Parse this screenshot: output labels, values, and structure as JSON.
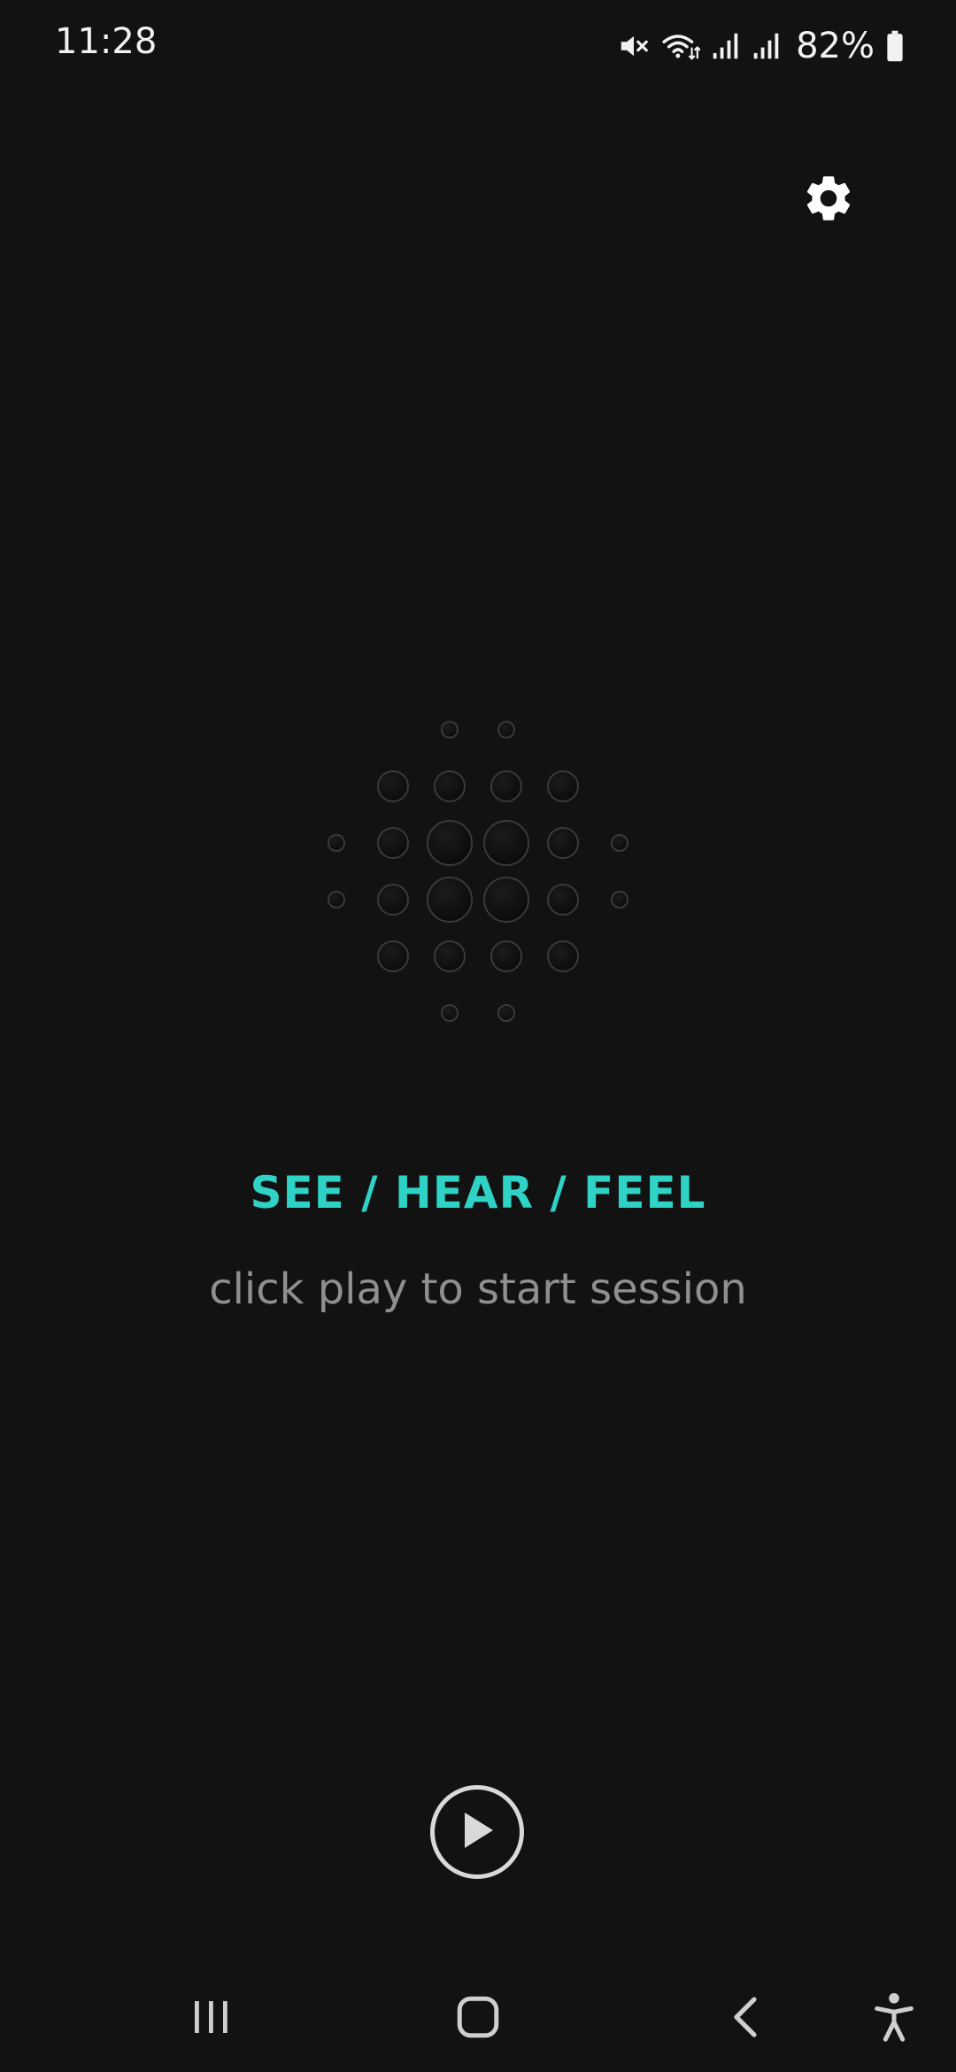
{
  "status_bar": {
    "time": "11:28",
    "battery_percent": "82%",
    "icons": [
      "mute-icon",
      "wifi-icon",
      "signal-icon",
      "signal-icon",
      "battery-icon"
    ]
  },
  "header": {
    "settings_icon": "gear-icon"
  },
  "main": {
    "logo_icon": "dot-grid-logo",
    "headline": "SEE / HEAR / FEEL",
    "subline": "click play to start session"
  },
  "controls": {
    "play_icon": "play-icon"
  },
  "nav_bar": {
    "items": [
      "recents-icon",
      "home-icon",
      "back-icon",
      "accessibility-icon"
    ]
  },
  "colors": {
    "background": "#121212",
    "accent": "#2ed3c6",
    "subtext": "#8f8f8f",
    "icon": "#ffffff"
  }
}
